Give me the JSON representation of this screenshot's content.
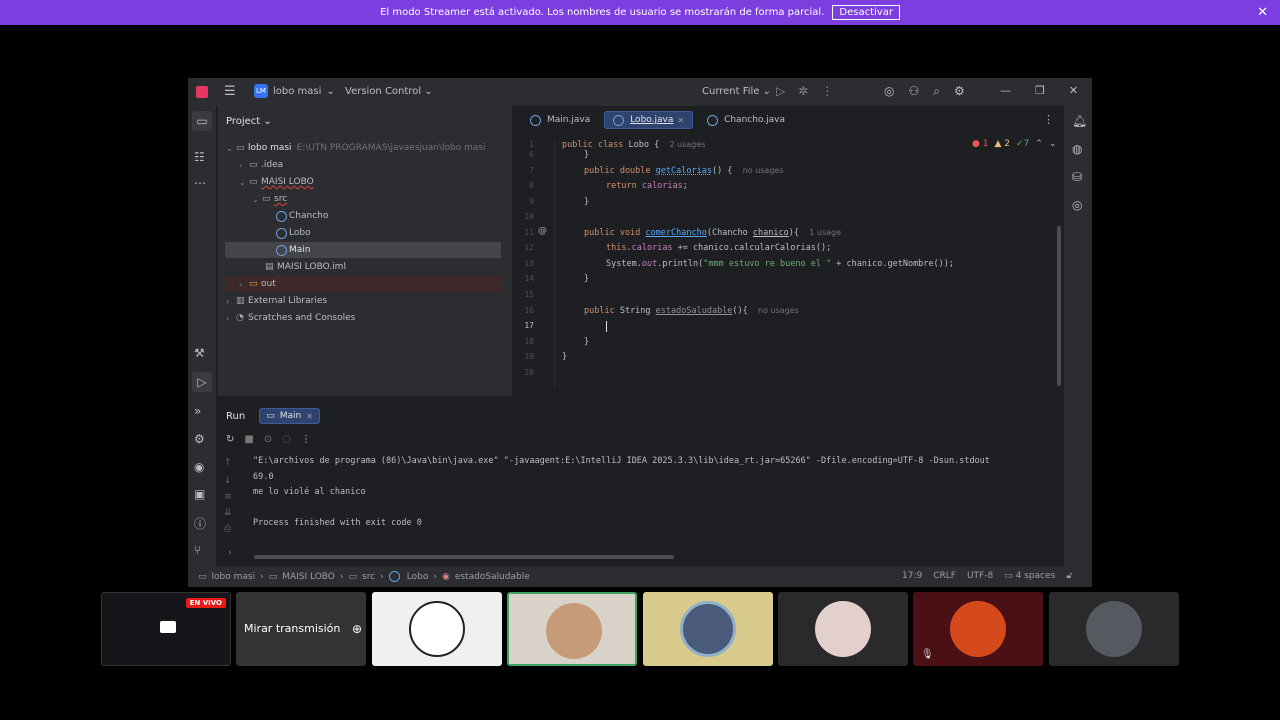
{
  "banner": {
    "message": "El modo Streamer está activado. Los nombres de usuario se mostrarán de forma parcial.",
    "button": "Desactivar"
  },
  "ide": {
    "project_badge": "LM",
    "project_name": "lobo masi",
    "vcs": "Version Control",
    "run_config": "Current File",
    "project_panel_title": "Project",
    "tree": [
      {
        "label": "lobo masi",
        "path": "E:\\UTN PROGRAMAS\\javaesjuan\\lobo masi"
      },
      {
        "label": ".idea"
      },
      {
        "label": "MAISI LOBO"
      },
      {
        "label": "src"
      },
      {
        "label": "Chancho"
      },
      {
        "label": "Lobo"
      },
      {
        "label": "Main"
      },
      {
        "label": "MAISI LOBO.iml"
      },
      {
        "label": "out"
      },
      {
        "label": "External Libraries"
      },
      {
        "label": "Scratches and Consoles"
      }
    ],
    "tabs": [
      "Main.java",
      "Lobo.java",
      "Chancho.java"
    ],
    "inspection": {
      "errors": "1",
      "warnings": "2",
      "ok": "7"
    },
    "line_numbers": [
      "1",
      "6",
      "7",
      "8",
      "9",
      "10",
      "11",
      "12",
      "13",
      "14",
      "15",
      "16",
      "17",
      "18",
      "19",
      "20"
    ],
    "code": {
      "l1_a": "public class ",
      "l1_b": "Lobo {",
      "l1_hint": "2 usages",
      "l6": "}",
      "l7_a": "public double ",
      "l7_b": "getCalorias",
      "l7_c": "() {",
      "l7_hint": "no usages",
      "l8_a": "return ",
      "l8_b": "calorias",
      "l8_c": ";",
      "l9": "}",
      "l11_a": "public void ",
      "l11_b": "comerChancho",
      "l11_c": "(Chancho ",
      "l11_d": "chanico",
      "l11_e": "){",
      "l11_hint": "1 usage",
      "l12_a": "this",
      "l12_b": ".",
      "l12_c": "calorias",
      "l12_d": " += chanico.calcularCalorias();",
      "l13_a": "System.",
      "l13_b": "out",
      "l13_c": ".println(",
      "l13_d": "\"mmm estuvo re bueno el \"",
      "l13_e": " + chanico.getNombre());",
      "l14": "}",
      "l16_a": "public ",
      "l16_b": "String ",
      "l16_c": "estadoSaludable",
      "l16_d": "(){",
      "l16_hint": "no usages",
      "l18": "}",
      "l19": "}"
    },
    "run": {
      "title": "Run",
      "tab": "Main",
      "lines": [
        "\"E:\\archivos de programa (86)\\Java\\bin\\java.exe\" \"-javaagent:E:\\IntelliJ IDEA 2025.3.3\\lib\\idea_rt.jar=65266\" -Dfile.encoding=UTF-8 -Dsun.stdout",
        "69.0",
        "me lo violé al chanico",
        "",
        "Process finished with exit code 0"
      ]
    },
    "breadcrumbs": [
      "lobo masi",
      "MAISI LOBO",
      "src",
      "Lobo",
      "estadoSaludable"
    ],
    "status": {
      "position": "17:9",
      "line_sep": "CRLF",
      "encoding": "UTF-8",
      "indent": "4 spaces"
    }
  },
  "stream": {
    "live_badge": "EN VIVO",
    "watch_label": "Mirar transmisión"
  }
}
